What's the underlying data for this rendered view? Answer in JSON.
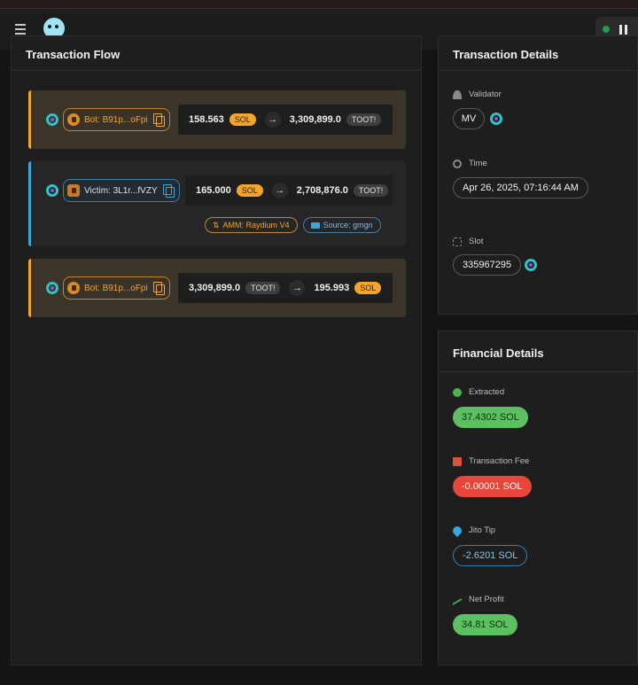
{
  "header": {
    "menu_icon": "menu-icon",
    "logo_icon": "app-logo-icon",
    "status_color": "#1ea04a",
    "pause_icon": "pause-icon"
  },
  "flow": {
    "title": "Transaction Flow",
    "rows": [
      {
        "kind": "bot",
        "address": "Bot: B91p...oFpi",
        "in_amount": "158.563",
        "in_token": "SOL",
        "out_amount": "3,309,899.0",
        "out_token": "TOOT!"
      },
      {
        "kind": "victim",
        "address": "Victim: 3L1r...fVZY",
        "in_amount": "165.000",
        "in_token": "SOL",
        "out_amount": "2,708,876.0",
        "out_token": "TOOT!",
        "amm": "AMM: Raydium V4",
        "source": "Source: gmgn"
      },
      {
        "kind": "bot",
        "address": "Bot: B91p...oFpi",
        "in_amount": "3,309,899.0",
        "in_token": "TOOT!",
        "out_amount": "195.993",
        "out_token": "SOL"
      }
    ]
  },
  "details": {
    "title": "Transaction Details",
    "validator_label": "Validator",
    "validator_value": "MV",
    "time_label": "Time",
    "time_value": "Apr 26, 2025, 07:16:44 AM",
    "slot_label": "Slot",
    "slot_value": "335967295"
  },
  "financial": {
    "title": "Financial Details",
    "extracted_label": "Extracted",
    "extracted_value": "37.4302 SOL",
    "fee_label": "Transaction Fee",
    "fee_value": "-0.00001 SOL",
    "tip_label": "Jito Tip",
    "tip_value": "-2.6201 SOL",
    "profit_label": "Net Profit",
    "profit_value": "34.81 SOL"
  },
  "colors": {
    "bot_accent": "#f2a52a",
    "victim_accent": "#3aa6e0",
    "positive": "#5cbf62",
    "negative": "#e8463a"
  }
}
